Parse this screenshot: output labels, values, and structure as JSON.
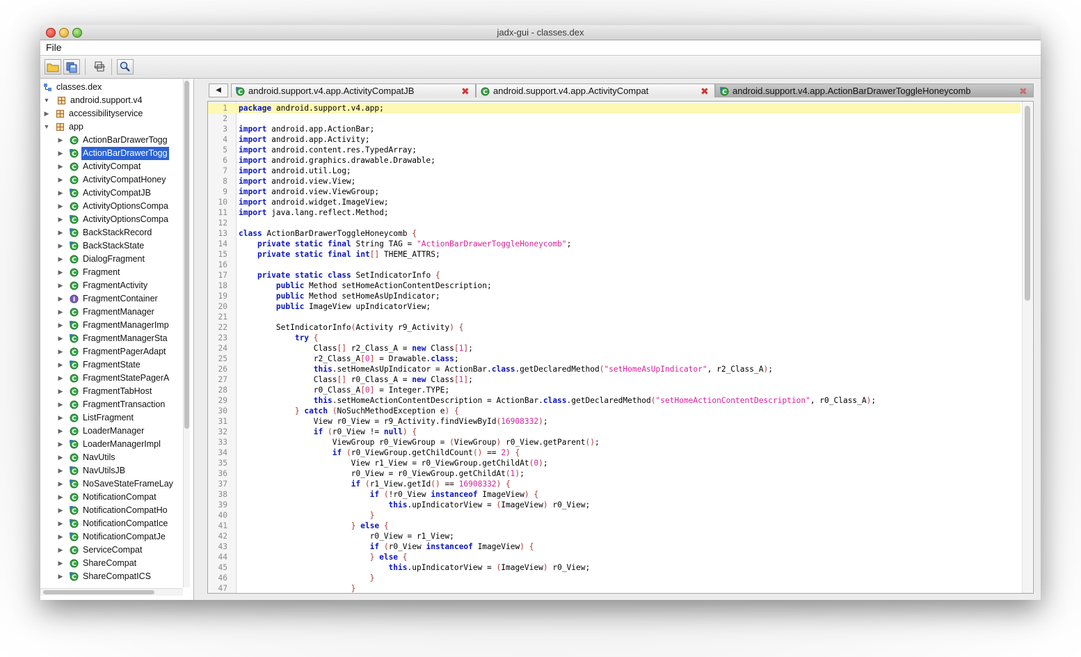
{
  "window": {
    "title": "jadx-gui - classes.dex"
  },
  "menu": {
    "file": "File"
  },
  "toolbar": {
    "buttons": [
      {
        "name": "open-file-icon"
      },
      {
        "name": "save-all-icon"
      },
      {
        "name": "sync-tree-icon"
      },
      {
        "name": "search-icon"
      }
    ]
  },
  "tree": {
    "rows": [
      {
        "label": "classes.dex",
        "level": 0,
        "arrow": "",
        "icon": "root"
      },
      {
        "label": "android.support.v4",
        "level": 0,
        "arrow": "down",
        "icon": "package"
      },
      {
        "label": "accessibilityservice",
        "level": 1,
        "arrow": "right",
        "icon": "package"
      },
      {
        "label": "app",
        "level": 1,
        "arrow": "down",
        "icon": "package"
      },
      {
        "label": "ActionBarDrawerTogg",
        "level": 2,
        "arrow": "right",
        "icon": "class"
      },
      {
        "label": "ActionBarDrawerTogg",
        "level": 2,
        "arrow": "right",
        "icon": "class-g",
        "selected": true
      },
      {
        "label": "ActivityCompat",
        "level": 2,
        "arrow": "right",
        "icon": "class"
      },
      {
        "label": "ActivityCompatHoney",
        "level": 2,
        "arrow": "right",
        "icon": "class"
      },
      {
        "label": "ActivityCompatJB",
        "level": 2,
        "arrow": "right",
        "icon": "class-g"
      },
      {
        "label": "ActivityOptionsCompa",
        "level": 2,
        "arrow": "right",
        "icon": "class"
      },
      {
        "label": "ActivityOptionsCompa",
        "level": 2,
        "arrow": "right",
        "icon": "class-g"
      },
      {
        "label": "BackStackRecord",
        "level": 2,
        "arrow": "right",
        "icon": "class-g"
      },
      {
        "label": "BackStackState",
        "level": 2,
        "arrow": "right",
        "icon": "class-g"
      },
      {
        "label": "DialogFragment",
        "level": 2,
        "arrow": "right",
        "icon": "class"
      },
      {
        "label": "Fragment",
        "level": 2,
        "arrow": "right",
        "icon": "class"
      },
      {
        "label": "FragmentActivity",
        "level": 2,
        "arrow": "right",
        "icon": "class"
      },
      {
        "label": "FragmentContainer",
        "level": 2,
        "arrow": "right",
        "icon": "interface"
      },
      {
        "label": "FragmentManager",
        "level": 2,
        "arrow": "right",
        "icon": "class"
      },
      {
        "label": "FragmentManagerImp",
        "level": 2,
        "arrow": "right",
        "icon": "class-g"
      },
      {
        "label": "FragmentManagerSta",
        "level": 2,
        "arrow": "right",
        "icon": "class-g"
      },
      {
        "label": "FragmentPagerAdapt",
        "level": 2,
        "arrow": "right",
        "icon": "class"
      },
      {
        "label": "FragmentState",
        "level": 2,
        "arrow": "right",
        "icon": "class-g"
      },
      {
        "label": "FragmentStatePagerA",
        "level": 2,
        "arrow": "right",
        "icon": "class"
      },
      {
        "label": "FragmentTabHost",
        "level": 2,
        "arrow": "right",
        "icon": "class"
      },
      {
        "label": "FragmentTransaction",
        "level": 2,
        "arrow": "right",
        "icon": "class"
      },
      {
        "label": "ListFragment",
        "level": 2,
        "arrow": "right",
        "icon": "class"
      },
      {
        "label": "LoaderManager",
        "level": 2,
        "arrow": "right",
        "icon": "class"
      },
      {
        "label": "LoaderManagerImpl",
        "level": 2,
        "arrow": "right",
        "icon": "class-g"
      },
      {
        "label": "NavUtils",
        "level": 2,
        "arrow": "right",
        "icon": "class"
      },
      {
        "label": "NavUtilsJB",
        "level": 2,
        "arrow": "right",
        "icon": "class-g"
      },
      {
        "label": "NoSaveStateFrameLay",
        "level": 2,
        "arrow": "right",
        "icon": "class-g"
      },
      {
        "label": "NotificationCompat",
        "level": 2,
        "arrow": "right",
        "icon": "class"
      },
      {
        "label": "NotificationCompatHo",
        "level": 2,
        "arrow": "right",
        "icon": "class-g"
      },
      {
        "label": "NotificationCompatIce",
        "level": 2,
        "arrow": "right",
        "icon": "class-g"
      },
      {
        "label": "NotificationCompatJe",
        "level": 2,
        "arrow": "right",
        "icon": "class-g"
      },
      {
        "label": "ServiceCompat",
        "level": 2,
        "arrow": "right",
        "icon": "class"
      },
      {
        "label": "ShareCompat",
        "level": 2,
        "arrow": "right",
        "icon": "class"
      },
      {
        "label": "ShareCompatICS",
        "level": 2,
        "arrow": "right",
        "icon": "class-g"
      }
    ]
  },
  "tabs": [
    {
      "label": "android.support.v4.app.ActivityCompatJB",
      "icon": "class-g",
      "active": false
    },
    {
      "label": "android.support.v4.app.ActivityCompat",
      "icon": "class",
      "active": false
    },
    {
      "label": "android.support.v4.app.ActionBarDrawerToggleHoneycomb",
      "icon": "class-g",
      "active": true
    }
  ],
  "tab_close_glyph": "✖",
  "tab_nav_glyph": "◀",
  "colors": {
    "keyword": "#0a16c2",
    "string": "#d8219c",
    "current_line": "#fdf8b2",
    "selection": "#2b63d4",
    "tab_close": "#d33333"
  },
  "code": {
    "current_line": 1,
    "lines": [
      "package android.support.v4.app;",
      "",
      "import android.app.ActionBar;",
      "import android.app.Activity;",
      "import android.content.res.TypedArray;",
      "import android.graphics.drawable.Drawable;",
      "import android.util.Log;",
      "import android.view.View;",
      "import android.view.ViewGroup;",
      "import android.widget.ImageView;",
      "import java.lang.reflect.Method;",
      "",
      "class ActionBarDrawerToggleHoneycomb {",
      "    private static final String TAG = \"ActionBarDrawerToggleHoneycomb\";",
      "    private static final int[] THEME_ATTRS;",
      "",
      "    private static class SetIndicatorInfo {",
      "        public Method setHomeActionContentDescription;",
      "        public Method setHomeAsUpIndicator;",
      "        public ImageView upIndicatorView;",
      "",
      "        SetIndicatorInfo(Activity r9_Activity) {",
      "            try {",
      "                Class[] r2_Class_A = new Class[1];",
      "                r2_Class_A[0] = Drawable.class;",
      "                this.setHomeAsUpIndicator = ActionBar.class.getDeclaredMethod(\"setHomeAsUpIndicator\", r2_Class_A);",
      "                Class[] r0_Class_A = new Class[1];",
      "                r0_Class_A[0] = Integer.TYPE;",
      "                this.setHomeActionContentDescription = ActionBar.class.getDeclaredMethod(\"setHomeActionContentDescription\", r0_Class_A);",
      "            } catch (NoSuchMethodException e) {",
      "                View r0_View = r9_Activity.findViewById(16908332);",
      "                if (r0_View != null) {",
      "                    ViewGroup r0_ViewGroup = (ViewGroup) r0_View.getParent();",
      "                    if (r0_ViewGroup.getChildCount() == 2) {",
      "                        View r1_View = r0_ViewGroup.getChildAt(0);",
      "                        r0_View = r0_ViewGroup.getChildAt(1);",
      "                        if (r1_View.getId() == 16908332) {",
      "                            if (!r0_View instanceof ImageView) {",
      "                                this.upIndicatorView = (ImageView) r0_View;",
      "                            }",
      "                        } else {",
      "                            r0_View = r1_View;",
      "                            if (r0_View instanceof ImageView) {",
      "                            } else {",
      "                                this.upIndicatorView = (ImageView) r0_View;",
      "                            }",
      "                        }"
    ]
  }
}
